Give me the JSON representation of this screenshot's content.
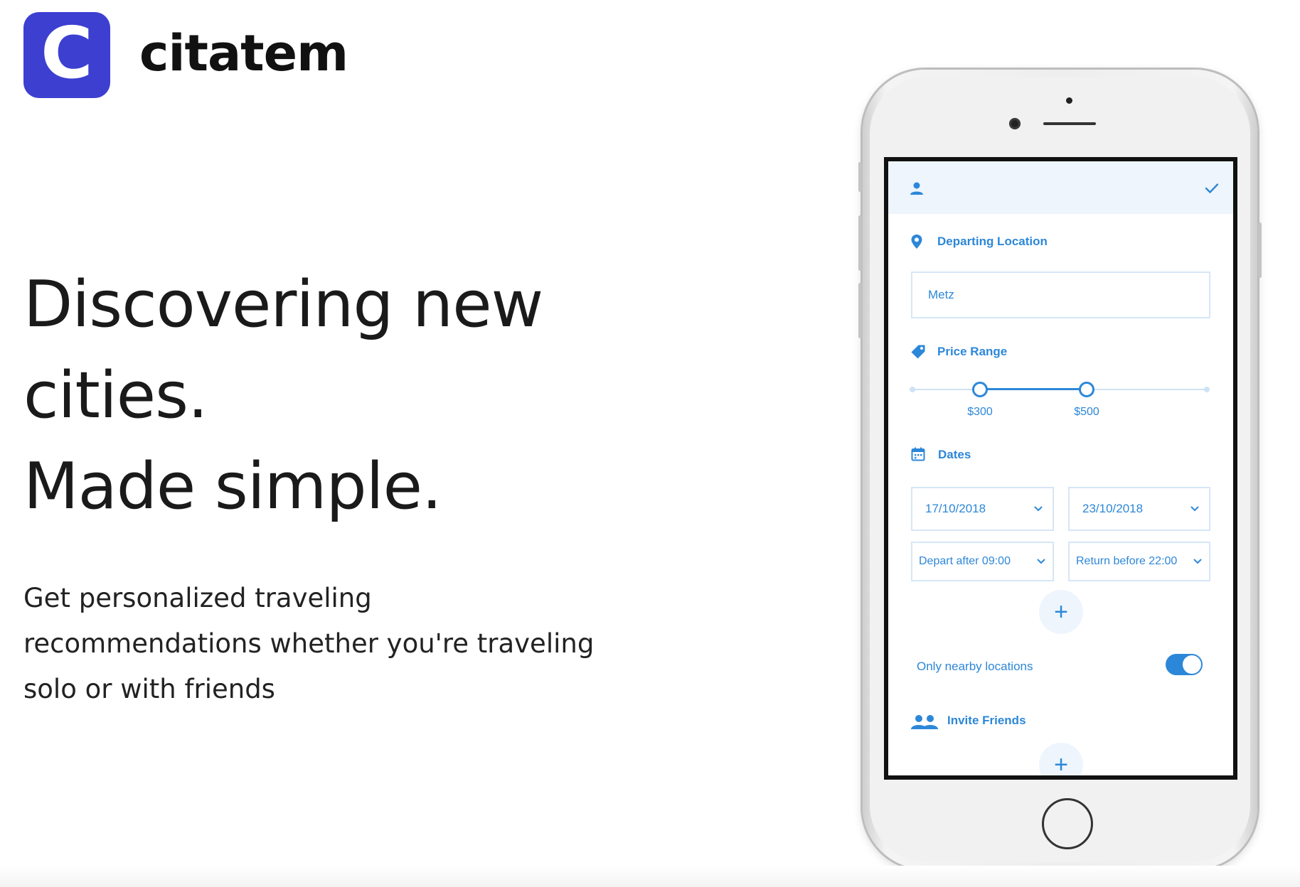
{
  "brand": {
    "logo_letter": "C",
    "name": "citatem",
    "logo_color": "#3d3fd1"
  },
  "hero": {
    "headline_lines": [
      "Discovering new",
      "cities.",
      "Made simple."
    ],
    "subtext_lines": [
      "Get personalized traveling",
      "recommendations whether you're traveling",
      "solo or with friends"
    ]
  },
  "app": {
    "accent_color": "#2d87d8",
    "header": {
      "left_icon": "profile-icon",
      "right_icon": "check-icon"
    },
    "departing": {
      "label": "Departing Location",
      "icon": "location-pin-icon",
      "value": "Metz"
    },
    "price": {
      "label": "Price Range",
      "icon": "price-tag-icon",
      "min_label": "$300",
      "max_label": "$500"
    },
    "dates": {
      "label": "Dates",
      "icon": "calendar-icon",
      "depart_date": "17/10/2018",
      "return_date": "23/10/2018",
      "depart_time": "Depart after 09:00",
      "return_time": "Return before 22:00",
      "add_label": "+"
    },
    "nearby": {
      "label": "Only nearby locations",
      "enabled": true
    },
    "invite": {
      "label": "Invite Friends",
      "icon": "group-icon",
      "add_label": "+"
    }
  }
}
